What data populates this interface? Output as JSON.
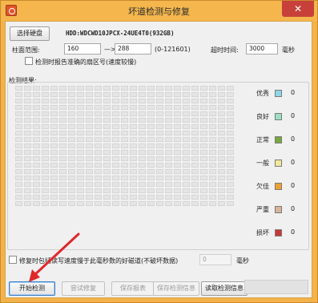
{
  "window": {
    "title": "坏道检测与修复",
    "close_glyph": "✕"
  },
  "disk": {
    "select_button": "选择硬盘",
    "info": "HDD:WDCWD10JPCX-24UE4T0(932GB)"
  },
  "range": {
    "label": "柱面范围:",
    "start": "160",
    "arrow": "—>",
    "end": "288",
    "hint": "(0-121601)"
  },
  "timeout": {
    "label": "超时时间:",
    "value": "3000",
    "unit": "毫秒"
  },
  "report_sector_checkbox": "检测时报告准确的扇区号(速度较慢)",
  "results": {
    "label": "检测结果:"
  },
  "legend": [
    {
      "label": "优秀",
      "count": "0",
      "color": "#8fd6e8"
    },
    {
      "label": "良好",
      "count": "0",
      "color": "#9be0c4"
    },
    {
      "label": "正常",
      "count": "0",
      "color": "#79a83c"
    },
    {
      "label": "一般",
      "count": "0",
      "color": "#f3e79a"
    },
    {
      "label": "欠佳",
      "count": "0",
      "color": "#f0a030"
    },
    {
      "label": "严重",
      "count": "0",
      "color": "#d9b49a"
    },
    {
      "label": "损坏",
      "count": "0",
      "color": "#c8383a"
    }
  ],
  "repair_option": {
    "label": "修复时包括读写速度慢于此毫秒数的好磁道(不破坏数据)",
    "value": "0",
    "unit": "毫秒"
  },
  "buttons": {
    "start": "开始检测",
    "try_repair": "尝试修复",
    "save_report": "保存报表",
    "save_info": "保存检测信息",
    "read_info": "读取检测信息"
  }
}
